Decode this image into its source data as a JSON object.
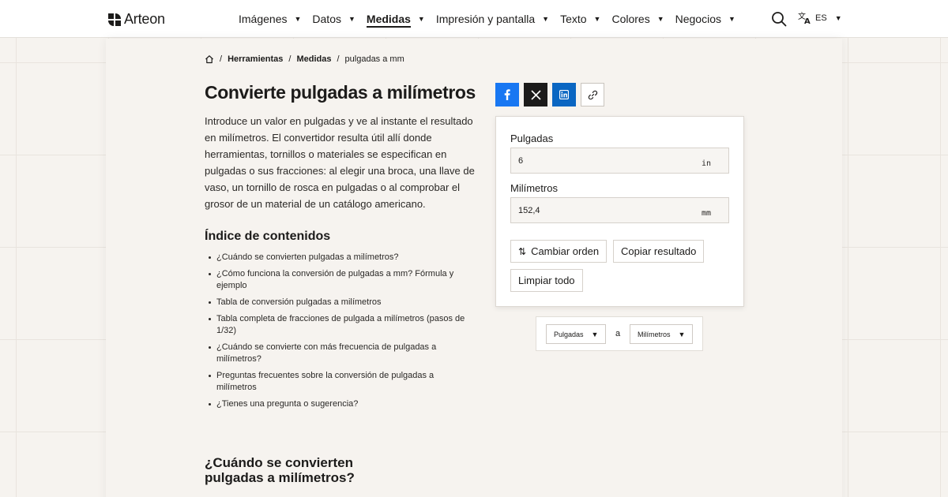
{
  "brand": {
    "name": "Arteon"
  },
  "nav": {
    "items": [
      {
        "label": "Imágenes",
        "active": false
      },
      {
        "label": "Datos",
        "active": false
      },
      {
        "label": "Medidas",
        "active": true
      },
      {
        "label": "Impresión y pantalla",
        "active": false
      },
      {
        "label": "Texto",
        "active": false
      },
      {
        "label": "Colores",
        "active": false
      },
      {
        "label": "Negocios",
        "active": false
      }
    ],
    "language": "ES"
  },
  "breadcrumb": {
    "items": [
      "Herramientas",
      "Medidas",
      "pulgadas a mm"
    ]
  },
  "page": {
    "title": "Convierte pulgadas a milímetros",
    "intro": "Introduce un valor en pulgadas y ve al instante el resultado en milímetros. El convertidor resulta útil allí donde herramientas, tornillos o materiales se especifican en pulgadas o sus fracciones: al elegir una broca, una llave de vaso, un tornillo de rosca en pulgadas o al comprobar el grosor de un material de un catálogo americano."
  },
  "toc": {
    "title": "Índice de contenidos",
    "items": [
      "¿Cuándo se convierten pulgadas a milímetros?",
      "¿Cómo funciona la conversión de pulgadas a mm? Fórmula y ejemplo",
      "Tabla de conversión pulgadas a milímetros",
      "Tabla completa de fracciones de pulgada a milímetros (pasos de 1/32)",
      "¿Cuándo se convierte con más frecuencia de pulgadas a milímetros?",
      "Preguntas frecuentes sobre la conversión de pulgadas a milímetros",
      "¿Tienes una pregunta o sugerencia?"
    ]
  },
  "section": {
    "title": "¿Cuándo se convierten pulgadas a milímetros?"
  },
  "converter": {
    "from_label": "Pulgadas",
    "from_value": "6",
    "from_unit": "in",
    "to_label": "Milímetros",
    "to_value": "152,4",
    "to_unit": "mm",
    "swap_label": "Cambiar orden",
    "copy_label": "Copiar resultado",
    "clear_label": "Limpiar todo"
  },
  "units": {
    "from": "Pulgadas",
    "connector": "a",
    "to": "Milímetros"
  },
  "colors": {
    "facebook": "#1877f2",
    "x": "#1c1b1a",
    "linkedin": "#0a66c2"
  }
}
